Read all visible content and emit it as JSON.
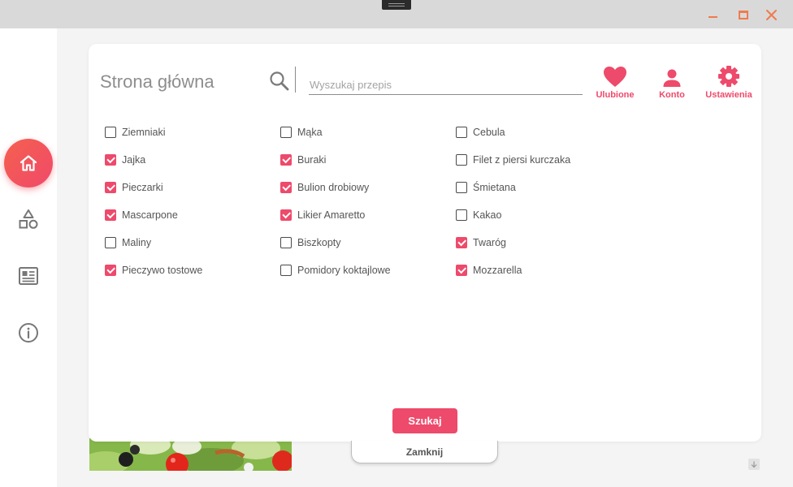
{
  "window": {
    "accent": "#ee4a6b",
    "controls": [
      "minimize-icon",
      "maximize-icon",
      "close-icon"
    ]
  },
  "sidebar": {
    "items": [
      {
        "name": "home",
        "icon": "home-icon",
        "active": true
      },
      {
        "name": "shapes",
        "icon": "shapes-icon",
        "active": false
      },
      {
        "name": "news",
        "icon": "newspaper-icon",
        "active": false
      },
      {
        "name": "info",
        "icon": "info-icon",
        "active": false
      }
    ]
  },
  "header": {
    "title": "Strona główna",
    "search_placeholder": "Wyszukaj przepis",
    "search_value": "",
    "actions": {
      "favorites": "Ulubione",
      "account": "Konto",
      "settings": "Ustawienia"
    }
  },
  "ingredients": [
    {
      "label": "Ziemniaki",
      "checked": false
    },
    {
      "label": "Jajka",
      "checked": true
    },
    {
      "label": "Pieczarki",
      "checked": true
    },
    {
      "label": "Mascarpone",
      "checked": true
    },
    {
      "label": "Maliny",
      "checked": false
    },
    {
      "label": "Pieczywo tostowe",
      "checked": true
    },
    {
      "label": "Mąka",
      "checked": false
    },
    {
      "label": "Buraki",
      "checked": true
    },
    {
      "label": "Bulion drobiowy",
      "checked": true
    },
    {
      "label": "Likier Amaretto",
      "checked": true
    },
    {
      "label": "Biszkopty",
      "checked": false
    },
    {
      "label": "Pomidory koktajlowe",
      "checked": false
    },
    {
      "label": "Cebula",
      "checked": false
    },
    {
      "label": "Filet z piersi kurczaka",
      "checked": false
    },
    {
      "label": "Śmietana",
      "checked": false
    },
    {
      "label": "Kakao",
      "checked": false
    },
    {
      "label": "Twaróg",
      "checked": true
    },
    {
      "label": "Mozzarella",
      "checked": true
    }
  ],
  "search_button": "Szukaj",
  "close_tab": "Zamknij"
}
